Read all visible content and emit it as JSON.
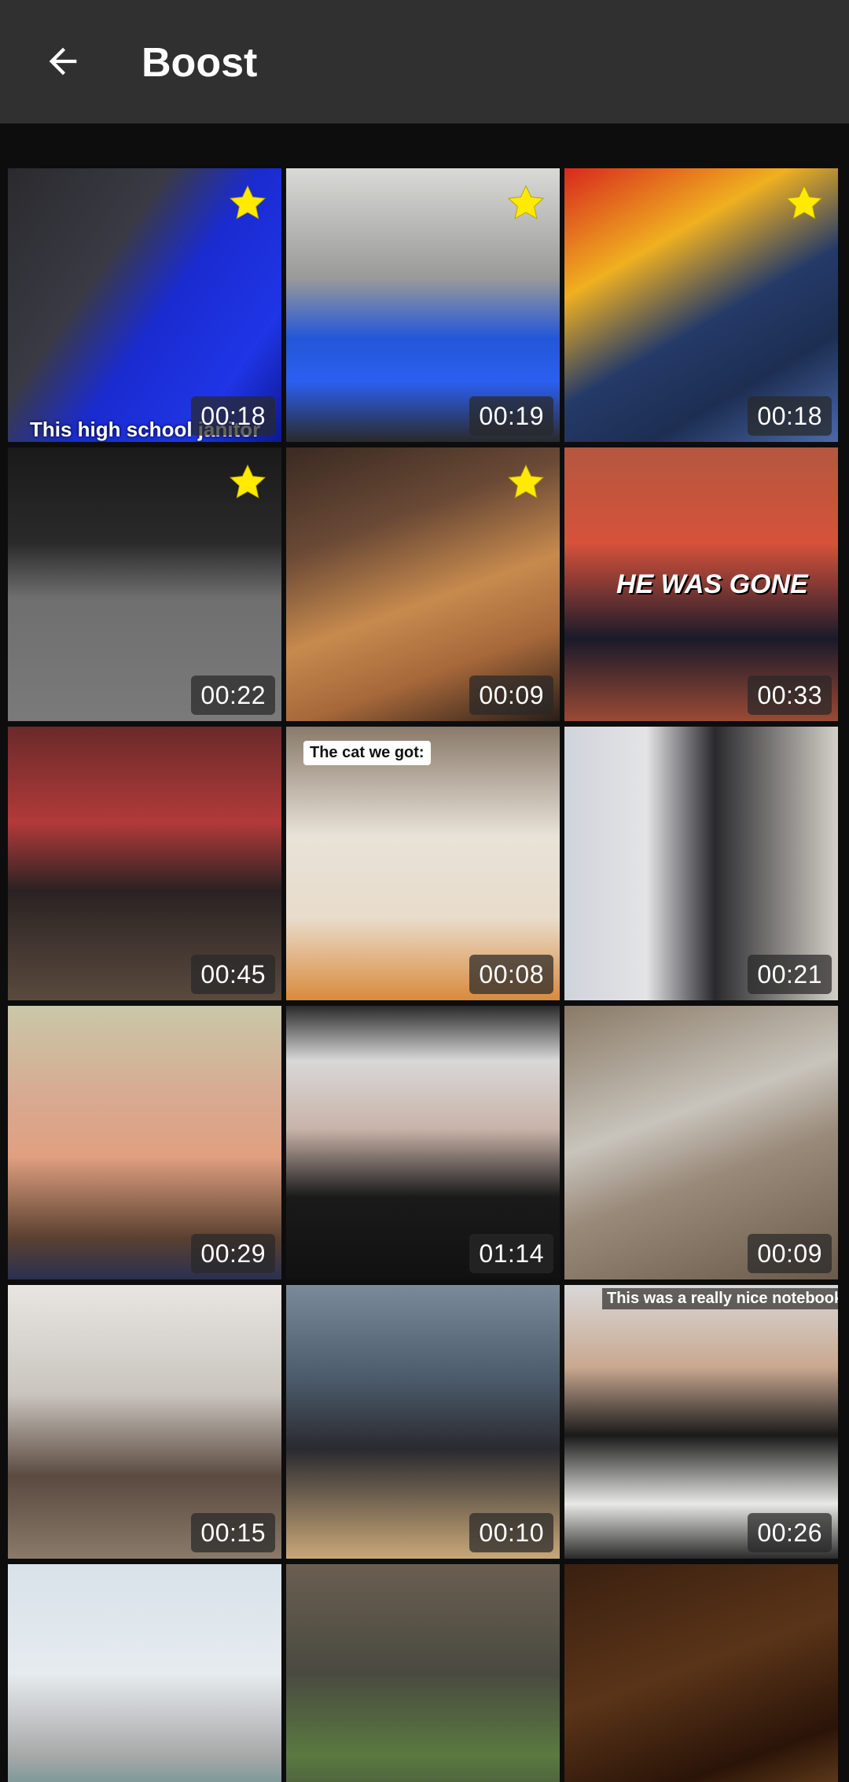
{
  "app_bar": {
    "title": "Boost",
    "back_icon": "arrow-left-icon"
  },
  "colors": {
    "app_bar": "#303030",
    "background": "#0d0d0d",
    "star": "#ffea00"
  },
  "tiles": [
    {
      "duration": "00:18",
      "starred": true,
      "caption": "This high school janitor",
      "bg": "linear-gradient(125deg,#2a2a2e 0%,#3a3a44 35%,#1a2bd0 55%,#1f35e6 80%,#0d1890 100%)"
    },
    {
      "duration": "00:19",
      "starred": true,
      "caption": "",
      "bg": "linear-gradient(180deg,#d9d9d6 0%,#9a9a98 40%,#2456d8 62%,#2b5ff0 78%,#2a2a2a 100%)"
    },
    {
      "duration": "00:18",
      "starred": true,
      "caption": "",
      "bg": "linear-gradient(150deg,#d8281e 0%,#f0b020 30%,#243a68 55%,#1d2e52 75%,#4a6aa8 100%)"
    },
    {
      "duration": "00:22",
      "starred": true,
      "caption": "",
      "bg": "linear-gradient(180deg,#1a1a1a 0%,#2a2a2a 35%,#6f6f6f 55%,#7a7a7a 100%)"
    },
    {
      "duration": "00:09",
      "starred": true,
      "caption": "",
      "bg": "linear-gradient(160deg,#3a2a22 0%,#6b4a36 30%,#c78a4e 55%,#a7683a 75%,#2a1e18 100%)"
    },
    {
      "duration": "00:33",
      "starred": false,
      "caption": "HE WAS GONE",
      "bg": "linear-gradient(180deg,#b4573f 0%,#d6523b 35%,#1a1a2a 70%,#9a4a35 100%)"
    },
    {
      "duration": "00:45",
      "starred": false,
      "caption": "",
      "bg": "linear-gradient(180deg,#6a2a2a 0%,#b23a3a 35%,#2a2222 60%,#5a4a3e 100%)"
    },
    {
      "duration": "00:08",
      "starred": false,
      "caption": "The cat we got:",
      "bg": "linear-gradient(180deg,#8a7a6a 0%,#e8e2d8 40%,#e8dccb 70%,#d98a3c 100%)"
    },
    {
      "duration": "00:21",
      "starred": false,
      "caption": "",
      "bg": "linear-gradient(90deg,#cfd3db 0%,#e4e4e6 30%,#2a2a2e 55%,#d4d0c8 100%)"
    },
    {
      "duration": "00:29",
      "starred": false,
      "caption": "",
      "bg": "linear-gradient(180deg,#c9c8a8 0%,#d8a890 35%,#e0a080 55%,#5a4030 85%,#2a3050 100%)"
    },
    {
      "duration": "01:14",
      "starred": false,
      "caption": "",
      "bg": "linear-gradient(180deg,#2a2a2a 0%,#d8d8d8 20%,#c9b3a8 45%,#1a1a1a 70%,#111111 100%)"
    },
    {
      "duration": "00:09",
      "starred": false,
      "caption": "",
      "bg": "linear-gradient(160deg,#8a7a66 0%,#c8c4bc 40%,#9a8a7a 60%,#6a5a4a 100%)"
    },
    {
      "duration": "00:15",
      "starred": false,
      "caption": "",
      "bg": "linear-gradient(180deg,#e8e6e2 0%,#c9c4be 40%,#5a4a40 70%,#8a7a6a 100%)"
    },
    {
      "duration": "00:10",
      "starred": false,
      "caption": "",
      "bg": "linear-gradient(180deg,#7a8a9a 0%,#4a5a6a 35%,#2a2a30 60%,#c9a878 100%)"
    },
    {
      "duration": "00:26",
      "starred": false,
      "caption": "This was a really nice notebook.",
      "bg": "linear-gradient(180deg,#d8d8d8 0%,#c9a890 30%,#1a1a1a 55%,#e8e8e6 80%,#2a2a2a 100%)"
    },
    {
      "duration": "",
      "starred": false,
      "caption": "",
      "bg": "linear-gradient(180deg,#d8e2ea 0%,#e6ebef 40%,#a8a8a8 70%,#2a7a7a 100%)"
    },
    {
      "duration": "",
      "starred": false,
      "caption": "",
      "bg": "linear-gradient(180deg,#6a5e50 0%,#4a4a40 40%,#5a7a40 70%,#3a3a38 100%)"
    },
    {
      "duration": "",
      "starred": false,
      "caption": "",
      "bg": "linear-gradient(160deg,#3a2010 0%,#5a3418 40%,#2a1408 70%,#8a5a2a 100%)"
    }
  ]
}
